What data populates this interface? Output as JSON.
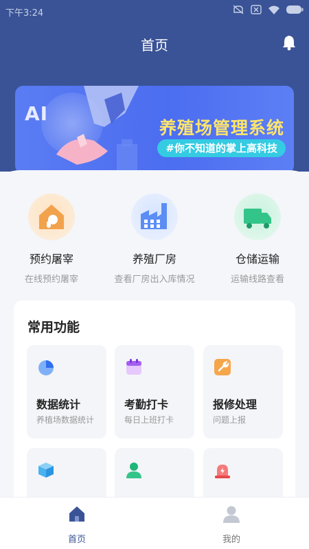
{
  "status": {
    "time": "下午3:24"
  },
  "topbar": {
    "title": "首页"
  },
  "banner": {
    "badge": "AI",
    "title": "养殖场管理系统",
    "tag": "#你不知道的掌上高科技"
  },
  "main_entries": [
    {
      "label": "预约屠宰",
      "sub": "在线预约屠宰",
      "icon": "house-chicken-icon",
      "color": "#f2a24c"
    },
    {
      "label": "养殖厂房",
      "sub": "查看厂房出入库情况",
      "icon": "factory-icon",
      "color": "#5b8df5"
    },
    {
      "label": "仓储运输",
      "sub": "运输线路查看",
      "icon": "truck-icon",
      "color": "#33c48a"
    }
  ],
  "common": {
    "title": "常用功能",
    "tiles": [
      {
        "label": "数据统计",
        "sub": "养植场数据统计",
        "icon": "pie-chart-icon"
      },
      {
        "label": "考勤打卡",
        "sub": "每日上班打卡",
        "icon": "calendar-icon"
      },
      {
        "label": "报修处理",
        "sub": "问题上报",
        "icon": "wrench-icon"
      },
      {
        "label": "",
        "sub": "",
        "icon": "box-icon"
      },
      {
        "label": "",
        "sub": "",
        "icon": "person-icon"
      },
      {
        "label": "",
        "sub": "",
        "icon": "alarm-icon"
      }
    ]
  },
  "tabbar": {
    "tabs": [
      {
        "label": "首页",
        "icon": "home-icon",
        "active": true
      },
      {
        "label": "我的",
        "icon": "user-icon",
        "active": false
      }
    ]
  },
  "colors": {
    "header": "#3a5396",
    "accent": "#3a5396",
    "banner_title": "#ffe56b",
    "tag": "#34cbe3"
  }
}
